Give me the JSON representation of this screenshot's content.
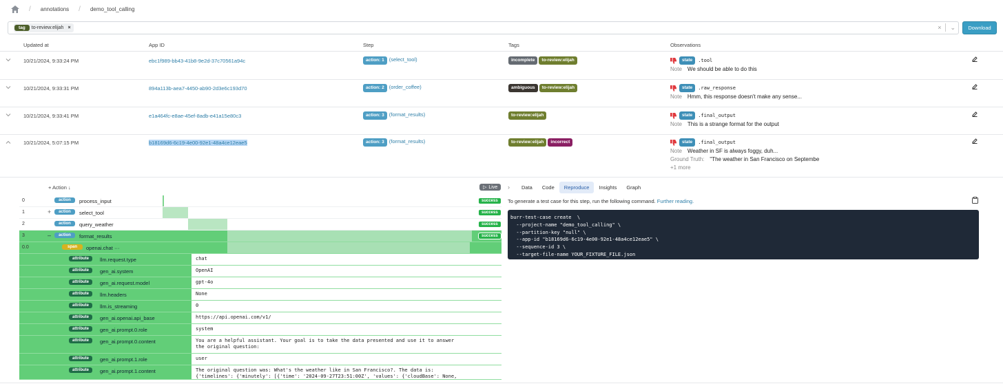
{
  "breadcrumb": {
    "items": [
      "annotations",
      "demo_tool_calling"
    ]
  },
  "filter": {
    "chip_kind": "tag",
    "chip_value": "to-review:elijah",
    "chip_remove": "×",
    "clear": "×",
    "open": "⌄"
  },
  "toolbar": {
    "download_label": "Download"
  },
  "table": {
    "columns": [
      "Updated at",
      "App ID",
      "Step",
      "Tags",
      "Observations"
    ],
    "rows": [
      {
        "updated": "10/21/2024, 9:33:24 PM",
        "app_id": "ebc1f989-bb43-41b8-9e2d-37c70561a94c",
        "action_badge": "action: 1",
        "action_name": "(select_tool)",
        "tags": [
          "incomplete",
          "to-review:elijah"
        ],
        "state_badge": "state",
        "field": ".tool",
        "note_label": "Note",
        "note": "We should be able to do this"
      },
      {
        "updated": "10/21/2024, 9:33:31 PM",
        "app_id": "894a113b-aea7-4450-ab90-2d3e6c193d70",
        "action_badge": "action: 2",
        "action_name": "(order_coffee)",
        "tags": [
          "ambiguous",
          "to-review:elijah"
        ],
        "state_badge": "state",
        "field": ".raw_response",
        "note_label": "Note",
        "note": "Hmm, this response doesn't make any sense..."
      },
      {
        "updated": "10/21/2024, 9:33:41 PM",
        "app_id": "e1a464fc-e8ae-45ef-8adb-e41a15e80c3",
        "action_badge": "action: 3",
        "action_name": "(format_results)",
        "tags": [
          "to-review:elijah"
        ],
        "state_badge": "state",
        "field": ".final_output",
        "note_label": "Note",
        "note": "This is a strange format for the output"
      },
      {
        "updated": "10/21/2024, 5:07:15 PM",
        "app_id": "b18169d6-6c19-4e00-92e1-48a4ce12eae5",
        "action_badge": "action: 3",
        "action_name": "(format_results)",
        "tags": [
          "to-review:elijah",
          "incorrect"
        ],
        "state_badge": "state",
        "field": ".final_output",
        "note_label": "Note",
        "note": "Weather in SF is always foggy, duh...",
        "gt_label": "Ground Truth:",
        "ground_truth": "\"The weather in San Francisco on Septembe",
        "more": "+1 more"
      }
    ]
  },
  "trace": {
    "add_action": "+ Action ↓",
    "live_label": "Live",
    "steps": [
      {
        "idx": "0",
        "type": "action",
        "name": "process_input",
        "status": "success"
      },
      {
        "idx": "1",
        "type": "action",
        "name": "select_tool",
        "status": "success"
      },
      {
        "idx": "2",
        "type": "action",
        "name": "query_weather",
        "status": "success"
      },
      {
        "idx": "3",
        "type": "action",
        "name": "format_results",
        "status": "success"
      }
    ],
    "span": {
      "idx": "0.0",
      "type": "span",
      "name": "openai.chat",
      "extra": "···"
    },
    "attributes": [
      {
        "type": "attribute",
        "key": "llm.request.type",
        "value": "chat"
      },
      {
        "type": "attribute",
        "key": "gen_ai.system",
        "value": "OpenAI"
      },
      {
        "type": "attribute",
        "key": "gen_ai.request.model",
        "value": "gpt-4o"
      },
      {
        "type": "attribute",
        "key": "llm.headers",
        "value": "None"
      },
      {
        "type": "attribute",
        "key": "llm.is_streaming",
        "value": "0"
      },
      {
        "type": "attribute",
        "key": "gen_ai.openai.api_base",
        "value": "https://api.openai.com/v1/"
      },
      {
        "type": "attribute",
        "key": "gen_ai.prompt.0.role",
        "value": "system"
      },
      {
        "type": "attribute",
        "key": "gen_ai.prompt.0.content",
        "value": "You are a helpful assistant. Your goal is to take the data presented and use it to answer\nthe original question:"
      },
      {
        "type": "attribute",
        "key": "gen_ai.prompt.1.role",
        "value": "user"
      },
      {
        "type": "attribute",
        "key": "gen_ai.prompt.1.content",
        "value": "The original question was: What's the weather like in San Francisco?. The data is:\n{'timelines': {'minutely': [{'time': '2024-09-27T23:51:00Z', 'values': {'cloudBase': None,"
      }
    ]
  },
  "detail": {
    "tabs": [
      "Data",
      "Code",
      "Reproduce",
      "Insights",
      "Graph"
    ],
    "active_tab": "Reproduce",
    "intro": "To generate a test case for this step, run the following command.",
    "link": "Further reading.",
    "command": "burr-test-case create  \\\n  --project-name \"demo_tool_calling\" \\\n  --partition-key \"null\" \\\n  --app-id \"b18169d6-6c19-4e00-92e1-48a4ce12eae5\" \\\n  --sequence-id 3 \\\n  --target-file-name YOUR_FIXTURE_FILE.json"
  },
  "colors": {
    "accent": "#3a9ec4",
    "success": "#26b34a",
    "trace_green": "#62ce78",
    "thumbs_down": "#e0393e"
  }
}
